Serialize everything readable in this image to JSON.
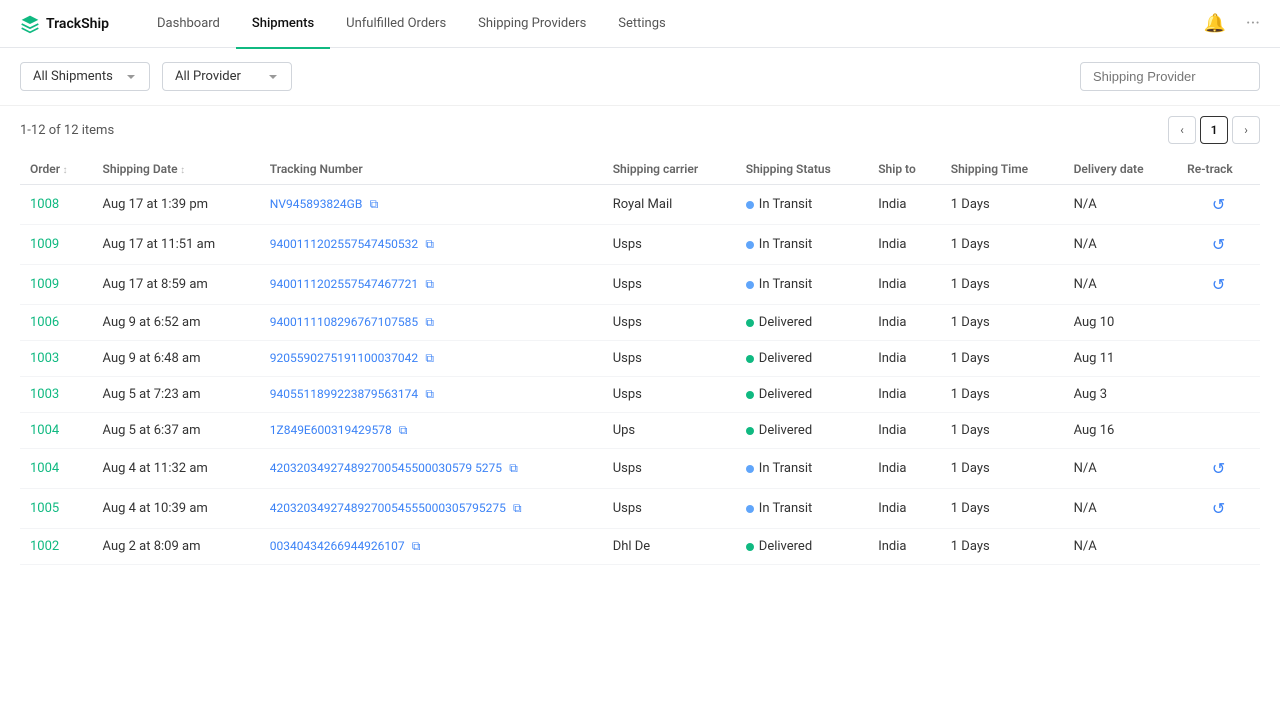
{
  "app": {
    "name": "TrackShip"
  },
  "nav": {
    "items": [
      {
        "id": "dashboard",
        "label": "Dashboard",
        "active": false
      },
      {
        "id": "shipments",
        "label": "Shipments",
        "active": true
      },
      {
        "id": "unfulfilled",
        "label": "Unfulfilled Orders",
        "active": false
      },
      {
        "id": "providers",
        "label": "Shipping Providers",
        "active": false
      },
      {
        "id": "settings",
        "label": "Settings",
        "active": false
      }
    ]
  },
  "toolbar": {
    "all_shipments_label": "All Shipments",
    "all_provider_label": "All Provider",
    "shipping_provider_placeholder": "Shipping Provider"
  },
  "pagination": {
    "info": "1-12 of 12 items",
    "current_page": "1"
  },
  "table": {
    "columns": [
      "Order",
      "Shipping Date",
      "Tracking Number",
      "Shipping carrier",
      "Shipping Status",
      "Ship to",
      "Shipping Time",
      "Delivery date",
      "Re-track"
    ],
    "rows": [
      {
        "order": "1008",
        "date": "Aug 17 at 1:39 pm",
        "tracking": "NV945893824GB",
        "carrier": "Royal Mail",
        "status": "In Transit",
        "status_type": "in-transit",
        "ship_to": "India",
        "time": "1 Days",
        "delivery": "N/A",
        "retrack": true
      },
      {
        "order": "1009",
        "date": "Aug 17 at 11:51 am",
        "tracking": "9400111202557547450532",
        "carrier": "Usps",
        "status": "In Transit",
        "status_type": "in-transit",
        "ship_to": "India",
        "time": "1 Days",
        "delivery": "N/A",
        "retrack": true
      },
      {
        "order": "1009",
        "date": "Aug 17 at 8:59 am",
        "tracking": "9400111202557547467721",
        "carrier": "Usps",
        "status": "In Transit",
        "status_type": "in-transit",
        "ship_to": "India",
        "time": "1 Days",
        "delivery": "N/A",
        "retrack": true
      },
      {
        "order": "1006",
        "date": "Aug 9 at 6:52 am",
        "tracking": "9400111108296767107585",
        "carrier": "Usps",
        "status": "Delivered",
        "status_type": "delivered",
        "ship_to": "India",
        "time": "1 Days",
        "delivery": "Aug 10",
        "retrack": false
      },
      {
        "order": "1003",
        "date": "Aug 9 at 6:48 am",
        "tracking": "9205590275191100037042",
        "carrier": "Usps",
        "status": "Delivered",
        "status_type": "delivered",
        "ship_to": "India",
        "time": "1 Days",
        "delivery": "Aug 11",
        "retrack": false
      },
      {
        "order": "1003",
        "date": "Aug 5 at 7:23 am",
        "tracking": "9405511899223879563174",
        "carrier": "Usps",
        "status": "Delivered",
        "status_type": "delivered",
        "ship_to": "India",
        "time": "1 Days",
        "delivery": "Aug 3",
        "retrack": false
      },
      {
        "order": "1004",
        "date": "Aug 5 at 6:37 am",
        "tracking": "1Z849E600319429578",
        "carrier": "Ups",
        "status": "Delivered",
        "status_type": "delivered",
        "ship_to": "India",
        "time": "1 Days",
        "delivery": "Aug 16",
        "retrack": false
      },
      {
        "order": "1004",
        "date": "Aug 4 at 11:32 am",
        "tracking": "420320349274892700545500030579 5275",
        "carrier": "Usps",
        "status": "In Transit",
        "status_type": "in-transit",
        "ship_to": "India",
        "time": "1 Days",
        "delivery": "N/A",
        "retrack": true
      },
      {
        "order": "1005",
        "date": "Aug 4 at 10:39 am",
        "tracking": "42032034927489270054555000305795275",
        "carrier": "Usps",
        "status": "In Transit",
        "status_type": "in-transit",
        "ship_to": "India",
        "time": "1 Days",
        "delivery": "N/A",
        "retrack": true
      },
      {
        "order": "1002",
        "date": "Aug 2 at 8:09 am",
        "tracking": "00340434266944926107",
        "carrier": "Dhl De",
        "status": "Delivered",
        "status_type": "delivered",
        "ship_to": "India",
        "time": "1 Days",
        "delivery": "N/A",
        "retrack": false
      }
    ]
  }
}
